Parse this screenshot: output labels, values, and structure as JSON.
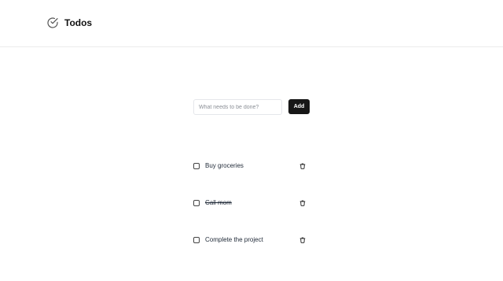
{
  "header": {
    "title": "Todos",
    "icon": "check-circle-icon"
  },
  "form": {
    "placeholder": "What needs to be done?",
    "value": "",
    "add_label": "Add"
  },
  "todos": [
    {
      "label": "Buy groceries",
      "completed": false
    },
    {
      "label": "Call mom",
      "completed": true
    },
    {
      "label": "Complete the project",
      "completed": false
    }
  ],
  "colors": {
    "accent": "#171717",
    "border": "#e5e7eb"
  }
}
